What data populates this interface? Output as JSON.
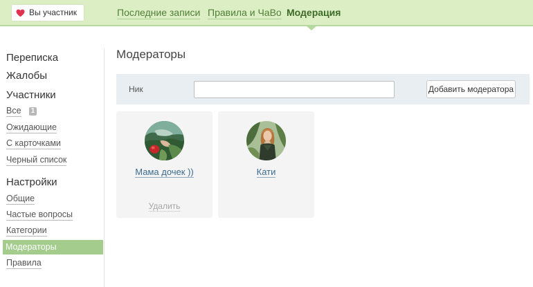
{
  "header": {
    "badge_label": "Вы участник",
    "badge_icon": "heart-icon",
    "nav": [
      {
        "label": "Последние записи"
      },
      {
        "label": "Правила и ЧаВо"
      },
      {
        "label": "Модерация",
        "active": true
      }
    ]
  },
  "sidebar": {
    "messages": "Переписка",
    "complaints": "Жалобы",
    "members": {
      "title": "Участники",
      "items": [
        {
          "label": "Все",
          "badge": "1"
        },
        {
          "label": "Ожидающие"
        },
        {
          "label": "С карточками"
        },
        {
          "label": "Черный список"
        }
      ]
    },
    "settings": {
      "title": "Настройки",
      "items": [
        {
          "label": "Общие"
        },
        {
          "label": "Частые вопросы"
        },
        {
          "label": "Категории"
        },
        {
          "label": "Модераторы",
          "active": true
        },
        {
          "label": "Правила"
        }
      ]
    }
  },
  "main": {
    "title": "Модераторы",
    "search": {
      "label": "Ник",
      "value": "",
      "button_label": "Добавить модератора"
    },
    "moderators": [
      {
        "name": "Мама дочек ))",
        "delete_label": "Удалить"
      },
      {
        "name": "Кати"
      }
    ]
  },
  "colors": {
    "header_bg": "#dcefc4",
    "accent": "#a3cc8d",
    "link_blue": "#3a6b93",
    "heart": "#e2334e"
  }
}
